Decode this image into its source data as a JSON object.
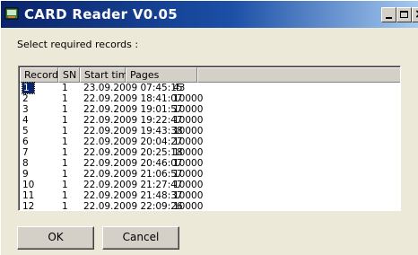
{
  "window": {
    "title": "CARD Reader  V0.05",
    "icon": "card-reader-app-icon",
    "minimize_icon": "minimize-icon",
    "maximize_icon": "maximize-icon",
    "close_icon": "close-icon",
    "close_glyph": "×"
  },
  "prompt": "Select required records :",
  "table": {
    "columns": [
      "Record",
      "SN",
      "Start time",
      "Pages"
    ],
    "rows": [
      {
        "record": "1",
        "sn": "1",
        "start_time": "23.09.2009 07:45:15",
        "pages": "43"
      },
      {
        "record": "2",
        "sn": "1",
        "start_time": "22.09.2009 18:41:07",
        "pages": "10000"
      },
      {
        "record": "3",
        "sn": "1",
        "start_time": "22.09.2009 19:01:57",
        "pages": "10000"
      },
      {
        "record": "4",
        "sn": "1",
        "start_time": "22.09.2009 19:22:47",
        "pages": "10000"
      },
      {
        "record": "5",
        "sn": "1",
        "start_time": "22.09.2009 19:43:38",
        "pages": "10000"
      },
      {
        "record": "6",
        "sn": "1",
        "start_time": "22.09.2009 20:04:27",
        "pages": "10000"
      },
      {
        "record": "7",
        "sn": "1",
        "start_time": "22.09.2009 20:25:18",
        "pages": "10000"
      },
      {
        "record": "8",
        "sn": "1",
        "start_time": "22.09.2009 20:46:07",
        "pages": "10000"
      },
      {
        "record": "9",
        "sn": "1",
        "start_time": "22.09.2009 21:06:57",
        "pages": "10000"
      },
      {
        "record": "10",
        "sn": "1",
        "start_time": "22.09.2009 21:27:47",
        "pages": "10000"
      },
      {
        "record": "11",
        "sn": "1",
        "start_time": "22.09.2009 21:48:37",
        "pages": "10000"
      },
      {
        "record": "12",
        "sn": "1",
        "start_time": "22.09.2009 22:09:26",
        "pages": "10000"
      }
    ],
    "selected_row": 0
  },
  "buttons": {
    "ok": "OK",
    "cancel": "Cancel"
  },
  "colors": {
    "title_bar_start": "#0a246a",
    "title_bar_end": "#a6caf0",
    "dialog_face": "#ece9d8",
    "selection": "#0a246a"
  }
}
